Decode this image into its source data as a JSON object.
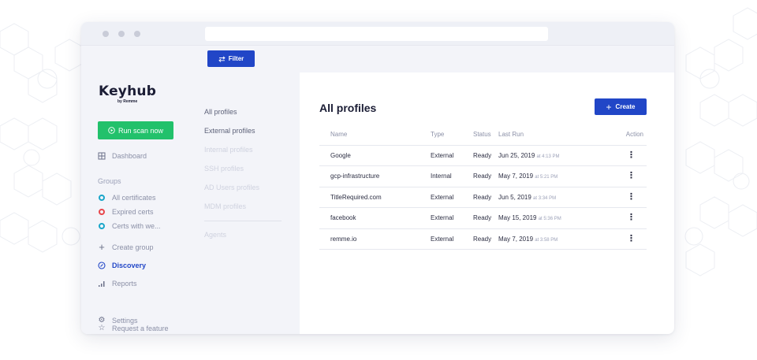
{
  "app": {
    "logo_main": "Keyhub",
    "logo_sub": "by Remme"
  },
  "sidebar": {
    "scan_button": "Run scan now",
    "dashboard": "Dashboard",
    "groups_label": "Groups",
    "groups": [
      {
        "label": "All certificates",
        "color": "#1aa6c9"
      },
      {
        "label": "Expired certs",
        "color": "#e8474c"
      },
      {
        "label": "Certs with we...",
        "color": "#1aa6c9"
      }
    ],
    "create_group": "Create group",
    "discovery": "Discovery",
    "reports": "Reports",
    "request_feature": "Request a feature",
    "settings": "Settings"
  },
  "subnav": {
    "filter_button": "Filter",
    "items": [
      "All profiles",
      "External profiles",
      "Internal profiles",
      "SSH profiles",
      "AD Users profiles",
      "MDM profiles"
    ],
    "agents": "Agents"
  },
  "main": {
    "title": "All profiles",
    "create_button": "Create",
    "columns": [
      "Name",
      "Type",
      "Status",
      "Last Run",
      "Action"
    ],
    "rows": [
      {
        "name": "Google",
        "type": "External",
        "status": "Ready",
        "date": "Jun 25, 2019",
        "time": "at 4:13 PM"
      },
      {
        "name": "gcp-infrastructure",
        "type": "Internal",
        "status": "Ready",
        "date": "May 7, 2019",
        "time": "at 5:21 PM"
      },
      {
        "name": "TitleRequired.com",
        "type": "External",
        "status": "Ready",
        "date": "Jun 5, 2019",
        "time": "at 3:34 PM"
      },
      {
        "name": "facebook",
        "type": "External",
        "status": "Ready",
        "date": "May 15, 2019",
        "time": "at 5:36 PM"
      },
      {
        "name": "remme.io",
        "type": "External",
        "status": "Ready",
        "date": "May 7, 2019",
        "time": "at 3:58 PM"
      }
    ]
  },
  "colors": {
    "accent": "#2146c7",
    "success": "#22c16b",
    "sidebar_bg": "#f3f4f9"
  }
}
